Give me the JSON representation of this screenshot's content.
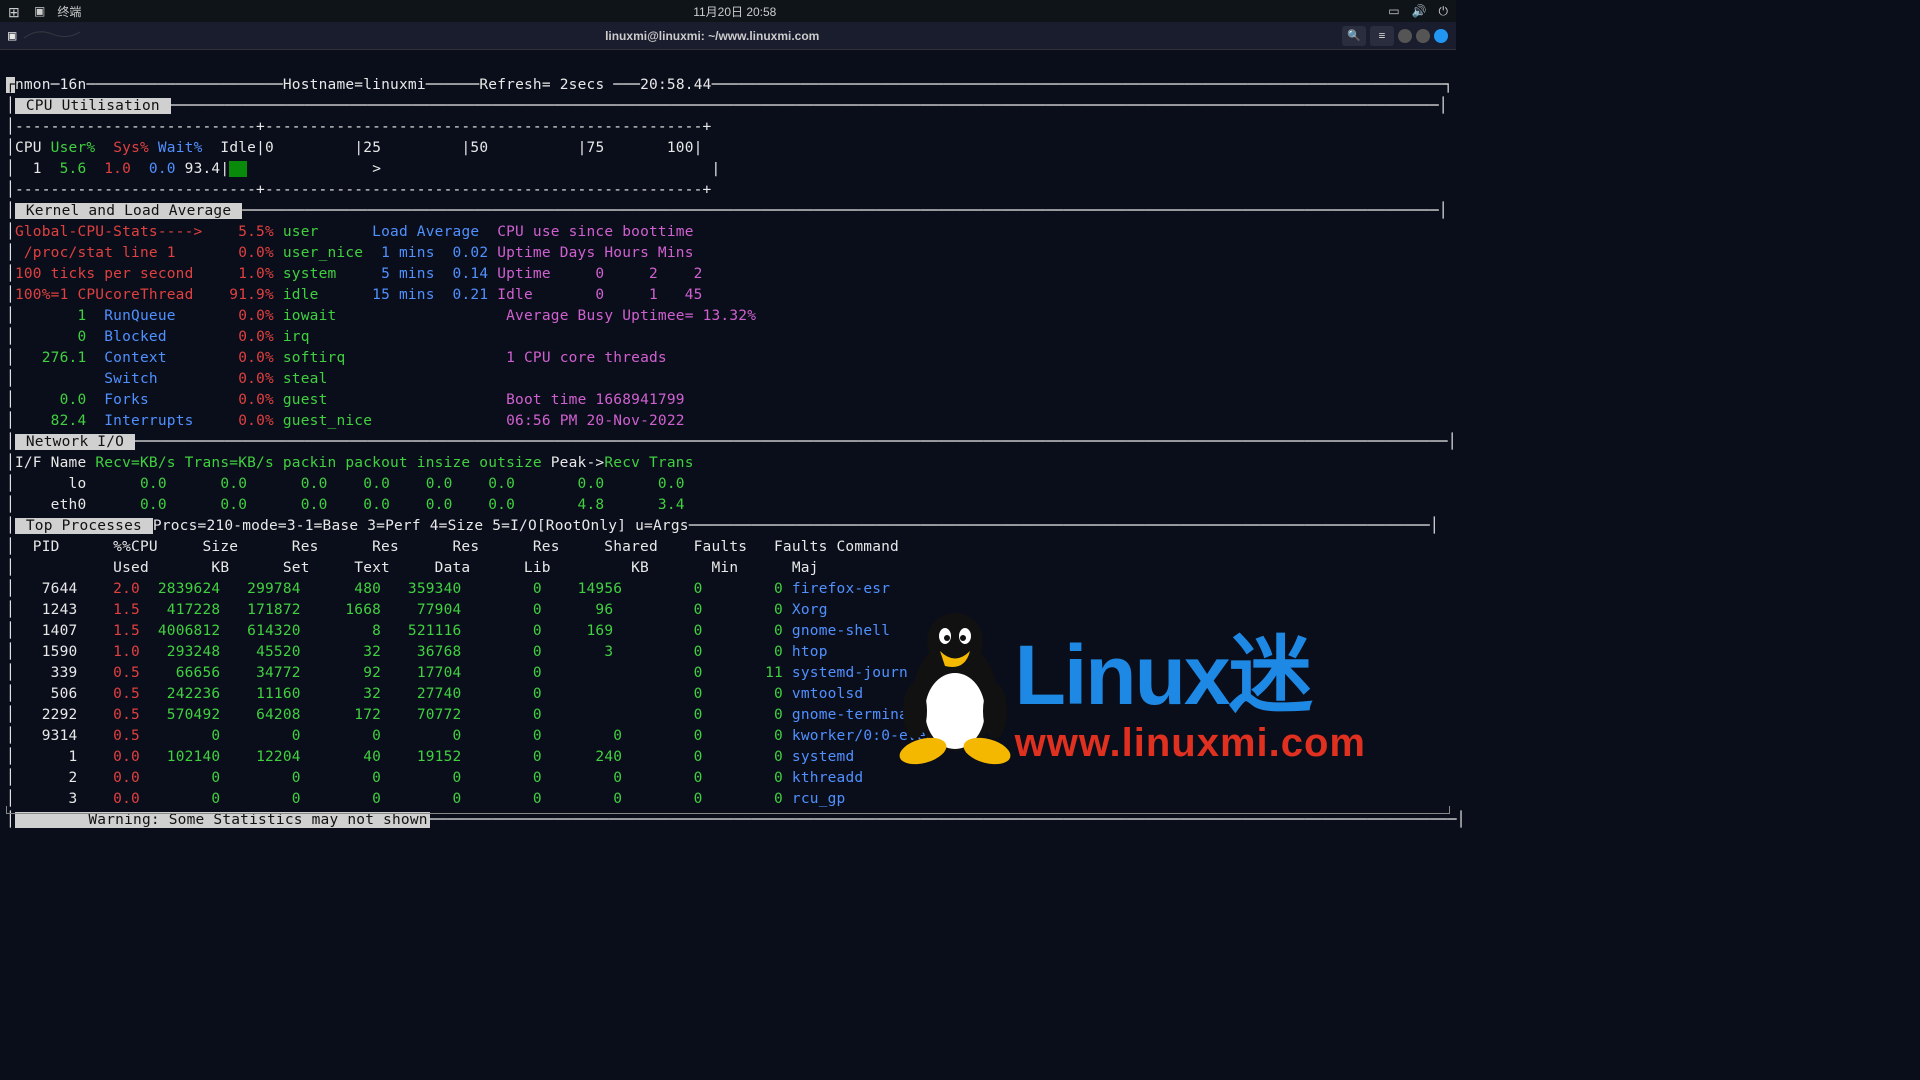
{
  "topbar": {
    "left_label": "终端",
    "clock": "11月20日 20:58"
  },
  "titlebar": {
    "title": "linuxmi@linuxmi: ~/www.linuxmi.com"
  },
  "header": {
    "app": "nmon─16n",
    "hostname_label": "Hostname=",
    "hostname": "linuxmi",
    "refresh_label": "Refresh= ",
    "refresh": "2secs",
    "time": "20:58.44"
  },
  "cpu_section": {
    "title": " CPU Utilisation ",
    "divider": "---------------------------+-------------------------------------------------+",
    "head_row": "CPU User%  Sys% Wait%  Idle|0         |25         |50          |75       100|",
    "row_cpu": "  1",
    "row_user": "  5.6",
    "row_sys": "  1.0",
    "row_wait": "  0.0",
    "row_idle": " 93.4",
    "row_bar": "UU",
    "row_tail": "              >                                     |"
  },
  "kernel": {
    "title": " Kernel and Load Average ",
    "l1_a": "Global-CPU-Stats---->",
    "l1_b": "    5.5%",
    "l1_c": " user      ",
    "l1_d": "Load Average  ",
    "l1_e": "CPU use since boottime",
    "l2_a": " /proc/stat line 1",
    "l2_b": "       0.0%",
    "l2_c": " user_nice ",
    "l2_d": " 1 mins  0.02 ",
    "l2_e": "Uptime Days Hours Mins",
    "l3_a": "100 ticks per second",
    "l3_b": "     1.0%",
    "l3_c": " system    ",
    "l3_d": " 5 mins  0.14 ",
    "l3_e": "Uptime     0     2    2",
    "l4_a": "100%=1 CPUcoreThread",
    "l4_b": "    91.9%",
    "l4_c": " idle      ",
    "l4_d": "15 mins  0.21 ",
    "l4_e": "Idle       0     1   45",
    "l5_a": "       1  ",
    "l5_b": "RunQueue",
    "l5_c": "       0.0%",
    "l5_d": " iowait",
    "l5_e": "                   Average Busy Uptimee= 13.32%",
    "l6_a": "       0  ",
    "l6_b": "Blocked",
    "l6_c": "        0.0%",
    "l6_d": " irq",
    "l7_a": "   276.1  ",
    "l7_b": "Context",
    "l7_c": "        0.0%",
    "l7_d": " softirq",
    "l7_e": "                  1 CPU core threads",
    "l8_b": "          Switch",
    "l8_c": "         0.0%",
    "l8_d": " steal",
    "l9_a": "     0.0  ",
    "l9_b": "Forks",
    "l9_c": "          0.0%",
    "l9_d": " guest",
    "l9_e": "                    Boot time 1668941799",
    "l10_a": "    82.4  ",
    "l10_b": "Interrupts",
    "l10_c": "     0.0%",
    "l10_d": " guest_nice",
    "l10_e": "               06:56 PM 20-Nov-2022"
  },
  "net": {
    "title": " Network I/O ",
    "head_a": "I/F Name ",
    "head_b": "Recv=KB/s Trans=KB/s packin packout insize outsize",
    "head_c": " Peak->",
    "head_d": "Recv Trans",
    "r1_name": "      lo",
    "r1_vals": "      0.0      0.0      0.0    0.0    0.0    0.0       0.0      0.0",
    "r2_name": "    eth0",
    "r2_vals": "      0.0      0.0      0.0    0.0    0.0    0.0       4.8      3.4"
  },
  "top": {
    "title": " Top Processes ",
    "tail": "Procs=210-mode=3-1=Base 3=Perf 4=Size 5=I/O[RootOnly] u=Args",
    "head1": "  PID      %%CPU     Size      Res      Res      Res      Res     Shared    Faults   Faults Command",
    "head2": "           Used       KB      Set     Text     Data      Lib         KB       Min      Maj",
    "rows": [
      {
        "pid": "   7644",
        "cpu": "    2.0",
        "size": "  2839624",
        "set": "   299784",
        "text": "      480",
        "data": "   359340",
        "lib": "        0",
        "sh": "    14956",
        "fmin": "        0",
        "fmaj": "        0",
        "cmd": " firefox-esr"
      },
      {
        "pid": "   1243",
        "cpu": "    1.5",
        "size": "   417228",
        "set": "   171872",
        "text": "     1668",
        "data": "    77904",
        "lib": "        0",
        "sh": "      96 ",
        "fmin": "        0",
        "fmaj": "        0",
        "cmd": " Xorg"
      },
      {
        "pid": "   1407",
        "cpu": "    1.5",
        "size": "  4006812",
        "set": "   614320",
        "text": "        8",
        "data": "   521116",
        "lib": "        0",
        "sh": "     169 ",
        "fmin": "        0",
        "fmaj": "        0",
        "cmd": " gnome-shell"
      },
      {
        "pid": "   1590",
        "cpu": "    1.0",
        "size": "   293248",
        "set": "    45520",
        "text": "       32",
        "data": "    36768",
        "lib": "        0",
        "sh": "       3 ",
        "fmin": "        0",
        "fmaj": "        0",
        "cmd": " htop"
      },
      {
        "pid": "    339",
        "cpu": "    0.5",
        "size": "    66656",
        "set": "    34772",
        "text": "       92",
        "data": "    17704",
        "lib": "        0",
        "sh": "         ",
        "fmin": "        0",
        "fmaj": "       11",
        "cmd": " systemd-journ"
      },
      {
        "pid": "    506",
        "cpu": "    0.5",
        "size": "   242236",
        "set": "    11160",
        "text": "       32",
        "data": "    27740",
        "lib": "        0",
        "sh": "         ",
        "fmin": "        0",
        "fmaj": "        0",
        "cmd": " vmtoolsd"
      },
      {
        "pid": "   2292",
        "cpu": "    0.5",
        "size": "   570492",
        "set": "    64208",
        "text": "      172",
        "data": "    70772",
        "lib": "        0",
        "sh": "         ",
        "fmin": "        0",
        "fmaj": "        0",
        "cmd": " gnome-terminal-"
      },
      {
        "pid": "   9314",
        "cpu": "    0.5",
        "size": "        0",
        "set": "        0",
        "text": "        0",
        "data": "        0",
        "lib": "        0",
        "sh": "        0",
        "fmin": "        0",
        "fmaj": "        0",
        "cmd": " kworker/0:0-events"
      },
      {
        "pid": "      1",
        "cpu": "    0.0",
        "size": "   102140",
        "set": "    12204",
        "text": "       40",
        "data": "    19152",
        "lib": "        0",
        "sh": "      240",
        "fmin": "        0",
        "fmaj": "        0",
        "cmd": " systemd"
      },
      {
        "pid": "      2",
        "cpu": "    0.0",
        "size": "        0",
        "set": "        0",
        "text": "        0",
        "data": "        0",
        "lib": "        0",
        "sh": "        0",
        "fmin": "        0",
        "fmaj": "        0",
        "cmd": " kthreadd"
      },
      {
        "pid": "      3",
        "cpu": "    0.0",
        "size": "        0",
        "set": "        0",
        "text": "        0",
        "data": "        0",
        "lib": "        0",
        "sh": "        0",
        "fmin": "        0",
        "fmaj": "        0",
        "cmd": " rcu_gp"
      }
    ],
    "warning": "        Warning: Some Statistics may not shown"
  },
  "watermark": {
    "text": "Linux",
    "mi": "迷",
    "url": "www.linuxmi.com"
  }
}
